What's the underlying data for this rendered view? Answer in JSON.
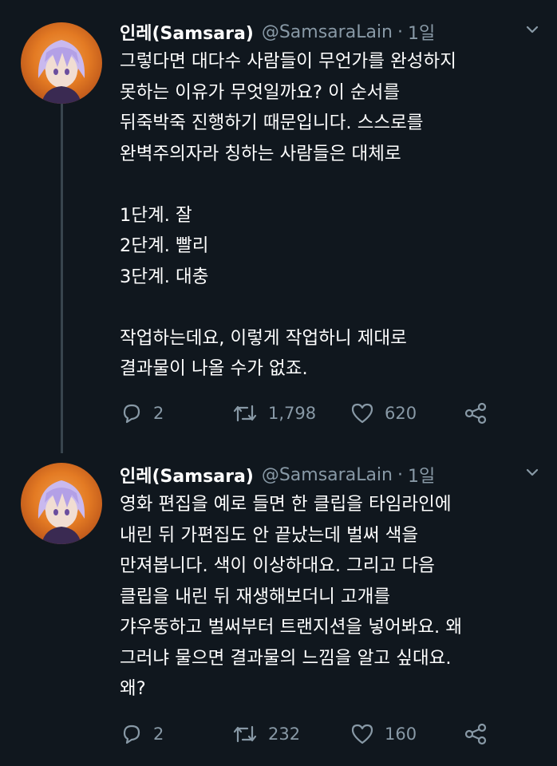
{
  "tweets": [
    {
      "name": "인레(Samsara)",
      "handle": "@SamsaraLain",
      "dot": "·",
      "time": "1일",
      "lines": [
        "그렇다면 대다수 사람들이 무언가를 완성하지",
        "못하는 이유가 무엇일까요? 이 순서를",
        "뒤죽박죽 진행하기 때문입니다. 스스로를",
        "완벽주의자라 칭하는 사람들은 대체로",
        "",
        "1단계. 잘",
        "2단계. 빨리",
        "3단계. 대충",
        "",
        "작업하는데요, 이렇게 작업하니 제대로",
        "결과물이 나올 수가 없죠."
      ],
      "replies": "2",
      "retweets": "1,798",
      "likes": "620"
    },
    {
      "name": "인레(Samsara)",
      "handle": "@SamsaraLain",
      "dot": "·",
      "time": "1일",
      "lines": [
        "영화 편집을 예로 들면 한 클립을 타임라인에",
        "내린 뒤 가편집도 안 끝났는데 벌써 색을",
        "만져봅니다. 색이 이상하대요. 그리고 다음",
        "클립을 내린 뒤 재생해보더니 고개를",
        "갸우뚱하고 벌써부터 트랜지션을 넣어봐요. 왜",
        "그러냐 물으면 결과물의 느낌을 알고 싶대요.",
        "왜?"
      ],
      "replies": "2",
      "retweets": "232",
      "likes": "160"
    }
  ],
  "icons": {
    "reply": "reply-icon",
    "retweet": "retweet-icon",
    "like": "heart-icon",
    "share": "share-icon",
    "caret": "chevron-down-icon"
  },
  "colors": {
    "background": "#10171e",
    "secondary_text": "#8899a6",
    "thread_line": "#38444d"
  }
}
